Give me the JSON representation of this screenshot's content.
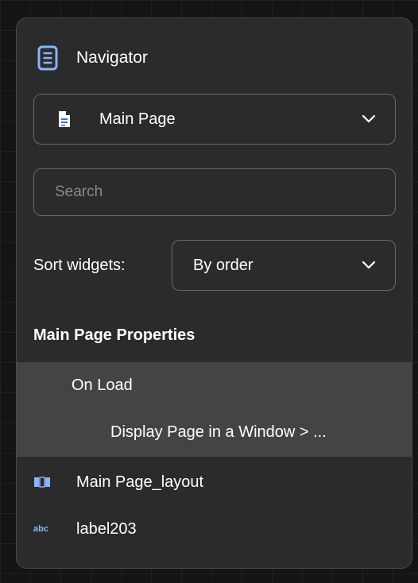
{
  "navigator": {
    "title": "Navigator",
    "title_icon": "document-list-icon",
    "accent_color": "#8ab4ff"
  },
  "page_select": {
    "value": "Main Page",
    "icon": "document-icon"
  },
  "search": {
    "placeholder": "Search",
    "value": ""
  },
  "sort": {
    "label": "Sort widgets:",
    "value": "By order"
  },
  "properties": {
    "title": "Main Page Properties",
    "event_label": "On Load",
    "action_label": "Display Page in a Window > ..."
  },
  "tree": {
    "items": [
      {
        "label": "Main Page_layout",
        "icon": "layout-icon"
      },
      {
        "label": "label203",
        "icon": "abc-label-icon",
        "icon_text": "abc"
      }
    ]
  }
}
